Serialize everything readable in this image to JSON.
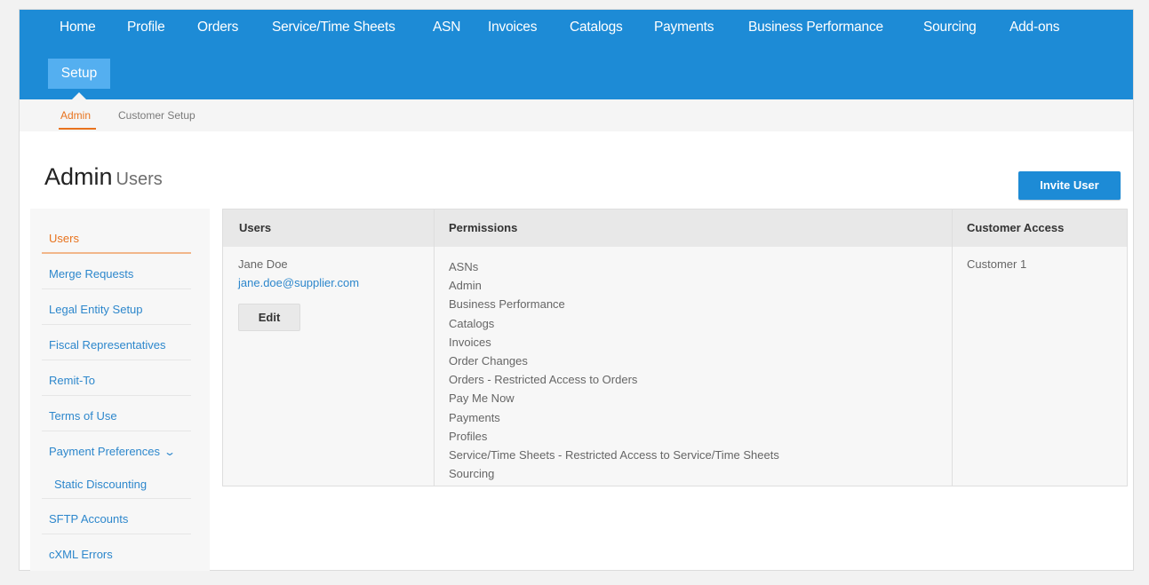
{
  "nav": {
    "items": [
      "Home",
      "Profile",
      "Orders",
      "Service/Time Sheets",
      "ASN",
      "Invoices",
      "Catalogs",
      "Payments",
      "Business Performance",
      "Sourcing",
      "Add-ons"
    ],
    "active": "Setup"
  },
  "subnav": {
    "items": [
      "Admin",
      "Customer Setup"
    ],
    "active": "Admin"
  },
  "page": {
    "title": "Admin",
    "subtitle": "Users",
    "invite_label": "Invite User"
  },
  "sidebar": {
    "items": [
      "Users",
      "Merge Requests",
      "Legal Entity Setup",
      "Fiscal Representatives",
      "Remit-To",
      "Terms of Use",
      "Payment Preferences",
      "Static Discounting",
      "SFTP Accounts",
      "cXML Errors"
    ],
    "active": "Users"
  },
  "table": {
    "headers": [
      "Users",
      "Permissions",
      "Customer Access"
    ],
    "rows": [
      {
        "name": "Jane Doe",
        "email": "jane.doe@supplier.com",
        "edit_label": "Edit",
        "permissions": [
          "ASNs",
          "Admin",
          "Business Performance",
          "Catalogs",
          "Invoices",
          "Order Changes",
          "Orders - Restricted Access to Orders",
          "Pay Me Now",
          "Payments",
          "Profiles",
          "Service/Time Sheets - Restricted Access to Service/Time Sheets",
          "Sourcing"
        ],
        "customer_access": "Customer 1"
      }
    ]
  },
  "colors": {
    "brand_blue": "#1d8bd6",
    "accent_orange": "#e8731e",
    "link_blue": "#2d87cc"
  }
}
